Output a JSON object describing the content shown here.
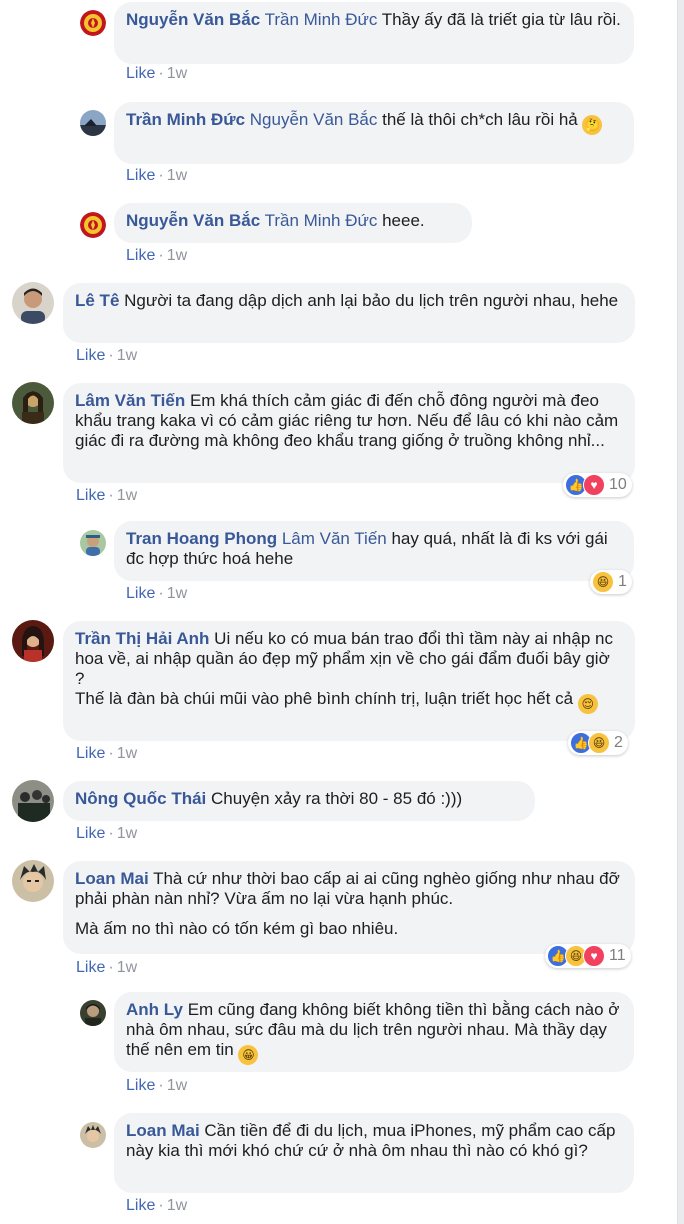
{
  "comments": [
    {
      "name": "Nguyễn Văn Bắc",
      "lines": [
        {
          "tag": "Trần Minh Đức",
          "text": " Thầy ấy đã là triết gia từ lâu rồi."
        }
      ],
      "like": "Like",
      "time": "1w",
      "avatar": "red-emblem-avatar"
    },
    {
      "name": "Trần Minh Đức",
      "lines": [
        {
          "tag": "Nguyễn Văn Bắc",
          "text": " thế là thôi ch*ch lâu rồi hả "
        }
      ],
      "emoji": "thinking-emoji",
      "like": "Like",
      "time": "1w",
      "avatar": "night-landscape-avatar"
    },
    {
      "name": "Nguyễn Văn Bắc",
      "lines": [
        {
          "tag": "Trần Minh Đức",
          "text": " heee."
        }
      ],
      "like": "Like",
      "time": "1w",
      "avatar": "red-emblem-avatar"
    },
    {
      "name": "Lê Tê",
      "lines": [
        {
          "tag": "",
          "text": " Người ta đang dập dịch anh lại bảo du lịch trên người nhau, hehe"
        }
      ],
      "like": "Like",
      "time": "1w",
      "avatar": "man-portrait-avatar"
    },
    {
      "name": "Lâm Văn Tiến",
      "lines": [
        {
          "tag": "",
          "text": " Em khá thích cảm giác đi đến chỗ đông người mà đeo khẩu trang kaka vì có cảm giác riêng tư hơn. Nếu để lâu có khi nào cảm giác đi ra đường mà không đeo khẩu trang giống ở truồng không nhỉ..."
        }
      ],
      "like": "Like",
      "time": "1w",
      "avatar": "mona-lisa-avatar",
      "reactions": {
        "icons": [
          "like",
          "love"
        ],
        "count": "10"
      }
    },
    {
      "name": "Tran Hoang Phong",
      "lines": [
        {
          "tag": "Lâm Văn Tiến",
          "text": " hay quá, nhất là đi ks với gái đc hợp thức hoá hehe"
        }
      ],
      "like": "Like",
      "time": "1w",
      "avatar": "outdoor-person-avatar",
      "reactions": {
        "icons": [
          "haha"
        ],
        "count": "1"
      }
    },
    {
      "name": "Trần Thị Hải Anh",
      "lines": [
        {
          "tag": "",
          "text": " Ui nếu ko có mua bán trao đổi thì tầm này ai nhập nc hoa về, ai nhập quần áo đẹp mỹ phẩm xịn về cho gái đẩm đuối bây giờ ?"
        },
        {
          "tag": "",
          "text": "Thế là đàn bà chúi mũi vào phê bình chính trị, luận triết học hết cả "
        }
      ],
      "emoji": "relieved-emoji",
      "like": "Like",
      "time": "1w",
      "avatar": "woman-red-avatar",
      "reactions": {
        "icons": [
          "like",
          "haha"
        ],
        "count": "2"
      }
    },
    {
      "name": "Nông Quốc Thái",
      "lines": [
        {
          "tag": "",
          "text": " Chuyện xảy ra thời 80 - 85 đó :)))"
        }
      ],
      "like": "Like",
      "time": "1w",
      "avatar": "group-photo-avatar"
    },
    {
      "name": "Loan Mai",
      "lines": [
        {
          "tag": "",
          "text": " Thà cứ như thời bao cấp ai ai cũng nghèo giống như nhau đỡ phải phàn nàn nhỉ? Vừa ấm no lại vừa hạnh phúc."
        },
        {
          "tag": "",
          "text": "Mà ấm no thì nào có tốn kém gì bao nhiêu."
        }
      ],
      "like": "Like",
      "time": "1w",
      "avatar": "anime-face-avatar",
      "reactions": {
        "icons": [
          "like",
          "haha",
          "love"
        ],
        "count": "11"
      }
    },
    {
      "name": "Anh Ly",
      "lines": [
        {
          "tag": "",
          "text": " Em cũng đang không biết không tiền thì bằng cách nào ở nhà ôm nhau, sức đâu mà du lịch trên người nhau. Mà thầy dạy thế nên em tin "
        }
      ],
      "emoji": "grin-emoji",
      "like": "Like",
      "time": "1w",
      "avatar": "dark-portrait-avatar"
    },
    {
      "name": "Loan Mai",
      "lines": [
        {
          "tag": "",
          "text": " Cần tiền để đi du lịch, mua iPhones, mỹ phẩm cao cấp này kia thì mới khó chứ cứ ở nhà ôm nhau thì nào có khó gì?"
        }
      ],
      "like": "Like",
      "time": "1w",
      "avatar": "anime-face-avatar"
    }
  ],
  "colors": {
    "name": "#385898",
    "bubble": "#f2f3f5",
    "meta": "#90949c",
    "like": "#4267b2"
  }
}
